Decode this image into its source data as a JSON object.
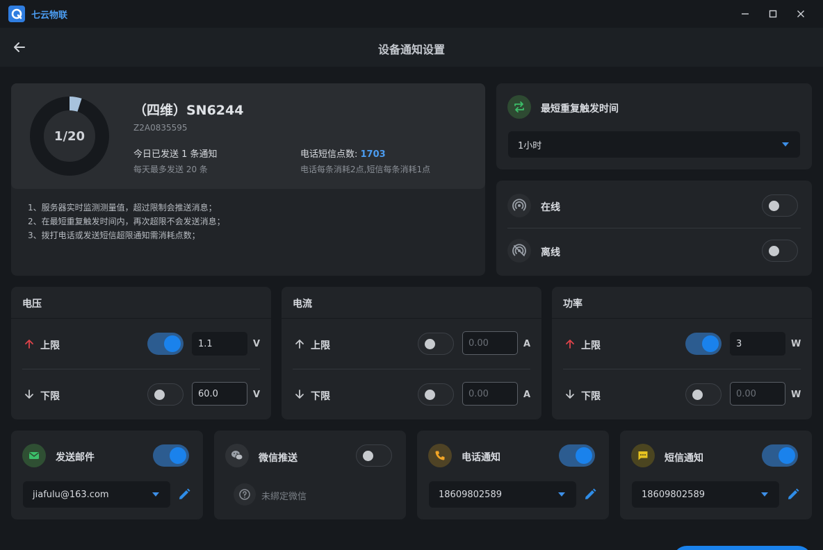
{
  "app": {
    "name": "七云物联"
  },
  "header": {
    "title": "设备通知设置"
  },
  "device": {
    "ring_text": "1/20",
    "ring_progress": 0.05,
    "name": "（四维）SN6244",
    "sn": "Z2A0835595",
    "sent_today": "今日已发送 1 条通知",
    "daily_max": "每天最多发送 20 条",
    "points_label": "电话短信点数: ",
    "points_value": "1703",
    "points_note": "电话每条消耗2点,短信每条消耗1点"
  },
  "notes": [
    "1、服务器实时监测测量值，超过限制会推送消息；",
    "2、在最短重复触发时间内，再次超限不会发送消息；",
    "3、拨打电话或发送短信超限通知需消耗点数；"
  ],
  "repeat": {
    "label": "最短重复触发时间",
    "value": "1小时"
  },
  "status": {
    "online_label": "在线",
    "online_on": false,
    "offline_label": "离线",
    "offline_on": false
  },
  "thresholds": {
    "upper_label": "上限",
    "lower_label": "下限",
    "voltage": {
      "title": "电压",
      "unit": "V",
      "upper_on": true,
      "upper_value": "1.1",
      "lower_on": false,
      "lower_value": "60.0"
    },
    "current": {
      "title": "电流",
      "unit": "A",
      "upper_on": false,
      "upper_placeholder": "0.00",
      "lower_on": false,
      "lower_placeholder": "0.00"
    },
    "power": {
      "title": "功率",
      "unit": "W",
      "upper_on": true,
      "upper_value": "3",
      "lower_on": false,
      "lower_placeholder": "0.00"
    }
  },
  "channels": {
    "email": {
      "label": "发送邮件",
      "on": true,
      "value": "jiafulu@163.com"
    },
    "wechat": {
      "label": "微信推送",
      "on": false,
      "hint": "未綁定微信"
    },
    "phone": {
      "label": "电话通知",
      "on": true,
      "value": "18609802589"
    },
    "sms": {
      "label": "短信通知",
      "on": true,
      "value": "18609802589"
    }
  },
  "colors": {
    "accent": "#1a82ec",
    "up_arrow": "#e0434a",
    "email_icon_bg": "#2f4f33",
    "phone_icon_bg": "#4f4325",
    "sms_icon_bg": "#4b4520",
    "repeat_icon_bg": "#2e4a32"
  }
}
